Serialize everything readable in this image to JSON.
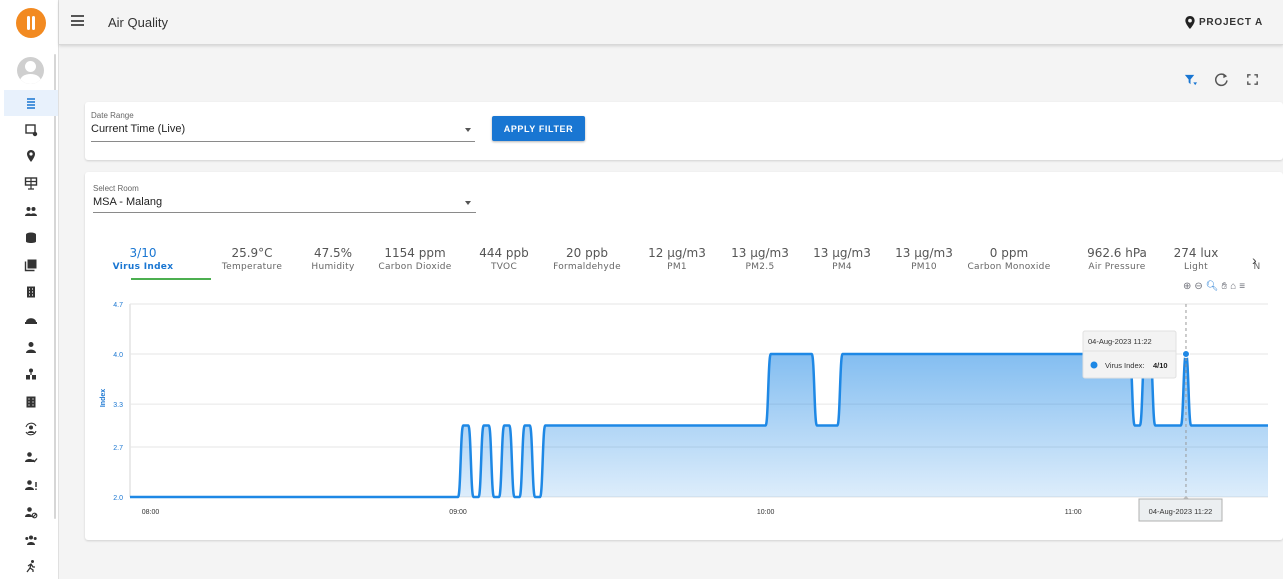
{
  "header": {
    "title": "Air Quality",
    "project": "PROJECT A"
  },
  "sidebar": {
    "items": [
      {
        "icon": "air-filter-icon",
        "active": true
      },
      {
        "icon": "dashboard-user-icon"
      },
      {
        "icon": "location-pin-icon"
      },
      {
        "icon": "presentation-board-icon"
      },
      {
        "icon": "people-icon"
      },
      {
        "icon": "database-icon"
      },
      {
        "icon": "library-icon"
      },
      {
        "icon": "building-icon"
      },
      {
        "icon": "hard-hat-icon"
      },
      {
        "icon": "person-icon"
      },
      {
        "icon": "org-chart-icon"
      },
      {
        "icon": "apartment-icon"
      },
      {
        "icon": "user-sync-icon"
      },
      {
        "icon": "user-check-icon"
      },
      {
        "icon": "user-alert-icon"
      },
      {
        "icon": "user-block-icon"
      },
      {
        "icon": "group-icon"
      },
      {
        "icon": "run-icon"
      }
    ]
  },
  "toolbar": {
    "icons": [
      "filter-icon",
      "refresh-icon",
      "fullscreen-icon"
    ],
    "accent": "#1976d2"
  },
  "filter": {
    "date_label": "Date Range",
    "date_value": "Current Time (Live)",
    "apply_label": "APPLY FILTER"
  },
  "room": {
    "label": "Select Room",
    "value": "MSA - Malang"
  },
  "metrics": [
    {
      "value": "3/10",
      "label": "Virus Index",
      "active": true
    },
    {
      "value": "25.9°C",
      "label": "Temperature"
    },
    {
      "value": "47.5%",
      "label": "Humidity"
    },
    {
      "value": "1154 ppm",
      "label": "Carbon Dioxide"
    },
    {
      "value": "444 ppb",
      "label": "TVOC"
    },
    {
      "value": "20 ppb",
      "label": "Formaldehyde"
    },
    {
      "value": "12 µg/m3",
      "label": "PM1"
    },
    {
      "value": "13 µg/m3",
      "label": "PM2.5"
    },
    {
      "value": "13 µg/m3",
      "label": "PM4"
    },
    {
      "value": "13 µg/m3",
      "label": "PM10"
    },
    {
      "value": "0 ppm",
      "label": "Carbon Monoxide"
    },
    {
      "value": "962.6 hPa",
      "label": "Air Pressure"
    },
    {
      "value": "274 lux",
      "label": "Light"
    },
    {
      "value": "",
      "label": "N"
    }
  ],
  "chart_data": {
    "type": "area",
    "ylabel": "Index",
    "ylim": [
      2.0,
      4.7
    ],
    "yticks": [
      "2.0",
      "2.7",
      "3.3",
      "4.0",
      "4.7"
    ],
    "xlim": [
      "07:56",
      "11:38"
    ],
    "xticks": [
      "08:00",
      "09:00",
      "10:00",
      "11:00"
    ],
    "grid": true,
    "color": "#1e88e5",
    "series": [
      {
        "name": "Virus Index",
        "x": [
          "07:56",
          "09:00",
          "09:01",
          "09:02",
          "09:03",
          "09:04",
          "09:05",
          "09:06",
          "09:07",
          "09:08",
          "09:09",
          "09:10",
          "09:11",
          "09:12",
          "09:13",
          "09:14",
          "09:15",
          "09:16",
          "09:17",
          "09:18",
          "10:00",
          "10:01",
          "10:09",
          "10:10",
          "10:14",
          "10:15",
          "11:11",
          "11:12",
          "11:13",
          "11:14",
          "11:15",
          "11:16",
          "11:17",
          "11:18",
          "11:19",
          "11:20",
          "11:21",
          "11:22",
          "11:23",
          "11:38"
        ],
        "y": [
          2,
          2,
          3,
          3,
          2,
          2,
          3,
          3,
          2,
          2,
          3,
          3,
          2,
          2,
          3,
          3,
          2,
          2,
          3,
          3,
          3,
          4,
          4,
          3,
          3,
          4,
          4,
          3,
          3,
          4,
          4,
          3,
          3,
          3,
          3,
          3,
          3,
          4,
          3,
          3
        ]
      }
    ],
    "tooltip": {
      "title": "04-Aug-2023 11:22",
      "series": "Virus Index:",
      "value": "4/10"
    },
    "crosshair_label": "04-Aug-2023 11:22"
  }
}
